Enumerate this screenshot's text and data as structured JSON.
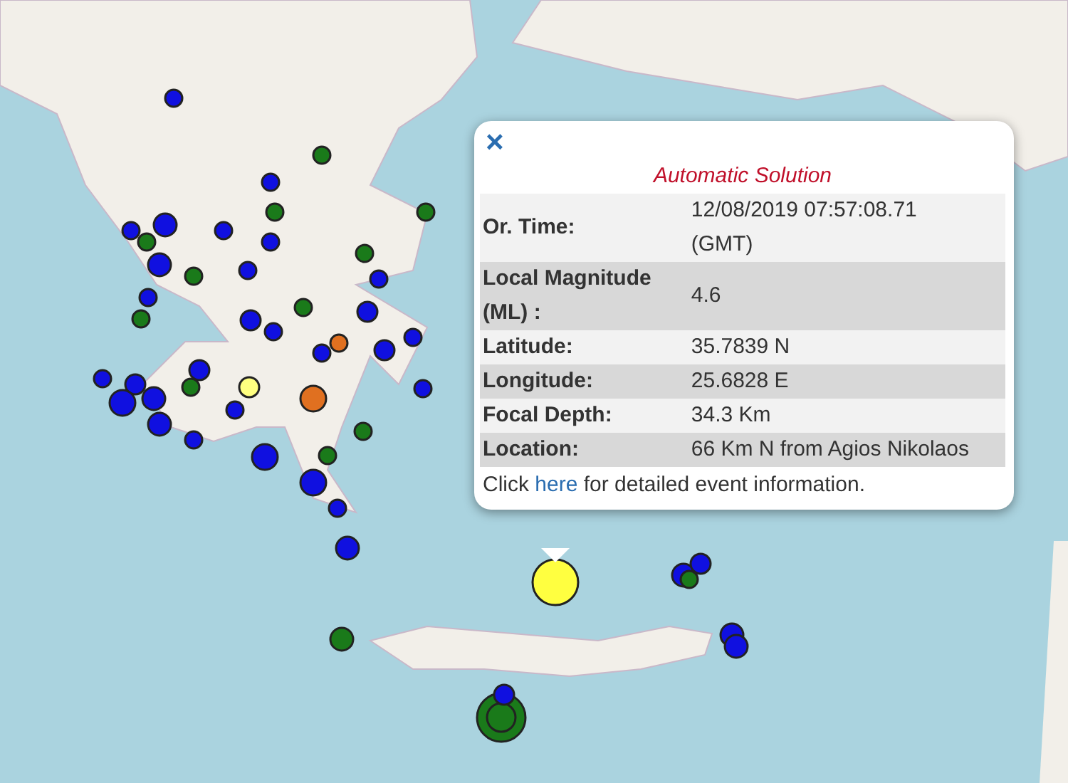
{
  "popup": {
    "close": "×",
    "title": "Automatic Solution",
    "rows": [
      {
        "label": "Or. Time:",
        "value": "12/08/2019 07:57:08.71 (GMT)"
      },
      {
        "label": "Local Magnitude (ML) :",
        "value": "4.6"
      },
      {
        "label": "Latitude:",
        "value": "35.7839 N"
      },
      {
        "label": "Longitude:",
        "value": "25.6828 E"
      },
      {
        "label": "Focal Depth:",
        "value": "34.3 Km"
      },
      {
        "label": "Location:",
        "value": "66 Km N from Agios Nikolaos"
      }
    ],
    "footer": {
      "before": "Click",
      "link": "here",
      "after": "for detailed event information."
    }
  }
}
